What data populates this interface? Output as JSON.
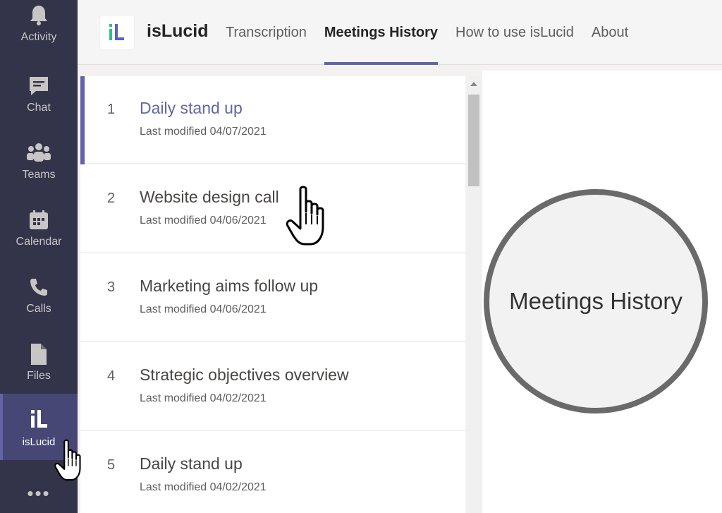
{
  "rail": {
    "items": [
      {
        "label": "Activity",
        "icon": "bell-icon"
      },
      {
        "label": "Chat",
        "icon": "chat-icon"
      },
      {
        "label": "Teams",
        "icon": "teams-icon"
      },
      {
        "label": "Calendar",
        "icon": "calendar-icon"
      },
      {
        "label": "Calls",
        "icon": "phone-icon"
      },
      {
        "label": "Files",
        "icon": "file-icon"
      },
      {
        "label": "isLucid",
        "icon": "islucid-logo-icon",
        "active": true
      }
    ],
    "more": "•••"
  },
  "header": {
    "app_title": "isLucid",
    "tabs": [
      {
        "label": "Transcription"
      },
      {
        "label": "Meetings History",
        "active": true
      },
      {
        "label": "How to use isLucid"
      },
      {
        "label": "About"
      }
    ]
  },
  "meetings": [
    {
      "num": "1",
      "title": "Daily stand up",
      "modified": "Last modified 04/07/2021",
      "selected": true
    },
    {
      "num": "2",
      "title": "Website design call",
      "modified": "Last modified 04/06/2021"
    },
    {
      "num": "3",
      "title": "Marketing aims follow up",
      "modified": "Last modified 04/06/2021"
    },
    {
      "num": "4",
      "title": "Strategic objectives overview",
      "modified": "Last modified 04/02/2021"
    },
    {
      "num": "5",
      "title": "Daily stand up",
      "modified": "Last modified 04/02/2021"
    }
  ],
  "magnifier": {
    "text": "Meetings History"
  },
  "colors": {
    "accent": "#6264a7",
    "rail_bg": "#33344a",
    "rail_active": "#464775",
    "logo_green": "#2ec27e"
  }
}
